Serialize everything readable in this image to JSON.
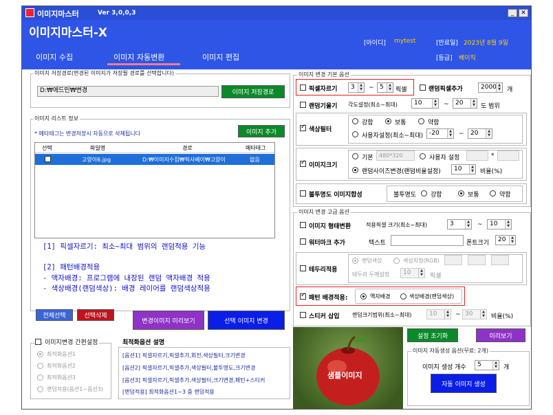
{
  "app": {
    "title": "이미지마스터",
    "version": "Ver 3,0,0,3",
    "heading": "이미지마스터-X",
    "minimize": "_",
    "close": "✕"
  },
  "account": {
    "id_label": "[아이디]",
    "id_value": "mytest",
    "expire_label": "[만료일]",
    "expire_value": "2023년 8월 9일",
    "grade_label": "[등급]",
    "grade_value": "베이직"
  },
  "tabs": [
    {
      "label": "이미지 수집"
    },
    {
      "label": "이미지 자동변환"
    },
    {
      "label": "이미지 편집"
    }
  ],
  "save_path": {
    "group_label": "이미지 저장경로(변경된 이미지가 저장될 경로를 선택합니다)",
    "value": "D:₩애드민₩변경",
    "button": "이미지 저장경로"
  },
  "image_list": {
    "group_label": "이미지 리스트 정보",
    "note": "* 메타태그는 변경저장시 자동으로 삭제됩니다",
    "add_button": "이미지 추가",
    "columns": [
      "선택",
      "파일명",
      "경로",
      "메타태그"
    ],
    "rows": [
      {
        "file": "고양이6.jpg",
        "path": "D:₩이미지수집₩픽사베이₩고양이",
        "meta": "없음"
      }
    ]
  },
  "help_text": {
    "line1": "[1] 픽셀자르기: 최소~최대 범위의 랜덤적용 기능",
    "line2": "[2] 패턴배경적용",
    "line3": "- 액자배경: 프로그램에 내장된 랜덤 액자배경 적용",
    "line4": "- 색상배경(랜덤색상): 배경 레이어를 랜덤색상적용"
  },
  "buttons": {
    "select_all": "전체선택",
    "delete_selected": "선택삭제",
    "preview_changed": "변경이미지 미리보기",
    "convert_selected": "선택 이미지 변경",
    "reset_settings": "설정 초기화",
    "preview": "미리보기",
    "auto_generate": "자동 이미지 생성"
  },
  "simple": {
    "group_label": "이미지변경 간편설정",
    "options": [
      "최적화옵션1",
      "최적화옵션2",
      "최적화옵션3",
      "랜덤적용(옵션1~옵션3)"
    ]
  },
  "opt_desc": {
    "title": "최적화옵션 설명",
    "lines": [
      "[옵션1] 픽셀자르기,픽셀추가,회전,색상필터,크기변경",
      "[옵션2] 픽셀자르기,픽셀추가,색상필터,불투명도,크기변경",
      "[옵션3] 픽셀자르기,픽셀추가,색상필터,크기변경,패턴+스티커",
      "[랜덤적용] 최적화옵션1~3 중 랜덤적용"
    ]
  },
  "sample_label": "샘플이미지",
  "basic": {
    "group_label": "이미지 변경 기본 옵션",
    "pixel_crop": {
      "label": "픽셀자르기",
      "min": "3",
      "tilde": "~",
      "max": "5",
      "unit": "픽셀"
    },
    "random_pixel": {
      "label": "랜덤픽셀추가",
      "value": "2000",
      "unit": "개"
    },
    "tilt": {
      "label": "랜덤기울기",
      "range_label": "각도설정(최소~최대)",
      "min": "10",
      "tilde": "~",
      "max": "20",
      "unit": "도 범위"
    },
    "color_filter": {
      "label": "색상필터",
      "strong": "강함",
      "normal": "보통",
      "weak": "약함",
      "custom": "사용자설정(최소~최대)",
      "min": "-20",
      "tilde": "~",
      "max": "20"
    },
    "size": {
      "label": "이미지크기",
      "basic": "기본",
      "basic_value": "480*320",
      "user": "사용자 설정",
      "star": "*",
      "random": "랜덤사이즈변경(랜덤비율설정)",
      "ratio": "10",
      "ratio_unit": "비율(%)"
    },
    "opacity": {
      "label": "불투명도 이미지합성",
      "opacity_label": "불투명도",
      "strong": "강함",
      "normal": "보통",
      "weak": "약함"
    }
  },
  "advanced": {
    "group_label": "이미지 변경 고급 옵션",
    "shape": {
      "label": "이미지 형태변환",
      "range_label": "적용픽셀 크기(최소~최대)",
      "min": "3",
      "tilde": "~",
      "max": "10"
    },
    "watermark": {
      "label": "워터마크 추가",
      "text_label": "텍스트",
      "font_label": "폰트크기",
      "font_size": "20"
    },
    "border": {
      "label": "테두리적용",
      "random_color": "랜덤색상",
      "color_rgb": "색상지정(RGB)",
      "thickness_label": "테두리 두께설정",
      "thickness": "10",
      "unit": "픽셀"
    },
    "pattern": {
      "label": "패턴 배경적용:",
      "frame": "액자배경",
      "color": "색상배경(랜덤색상)"
    },
    "sticker": {
      "label": "스티커 삽입",
      "range_label": "랜덤크기범위(최소~최대)",
      "min": "10",
      "tilde": "~",
      "max": "30",
      "unit": "비율(%)"
    }
  },
  "auto": {
    "group_label": "이미지 자동생성 옵션(무료: 2개)",
    "count_label": "이미지 생성 개수",
    "count": "5",
    "unit": "개"
  },
  "colors": {
    "header": "#2e55e6",
    "accent_green": "#0b8a2a",
    "accent_red": "#c0141c",
    "accent_blue": "#0a1ee8",
    "accent_purple": "#8e33c6",
    "highlight": "#e02020",
    "selected_row": "#1e6fd9"
  }
}
